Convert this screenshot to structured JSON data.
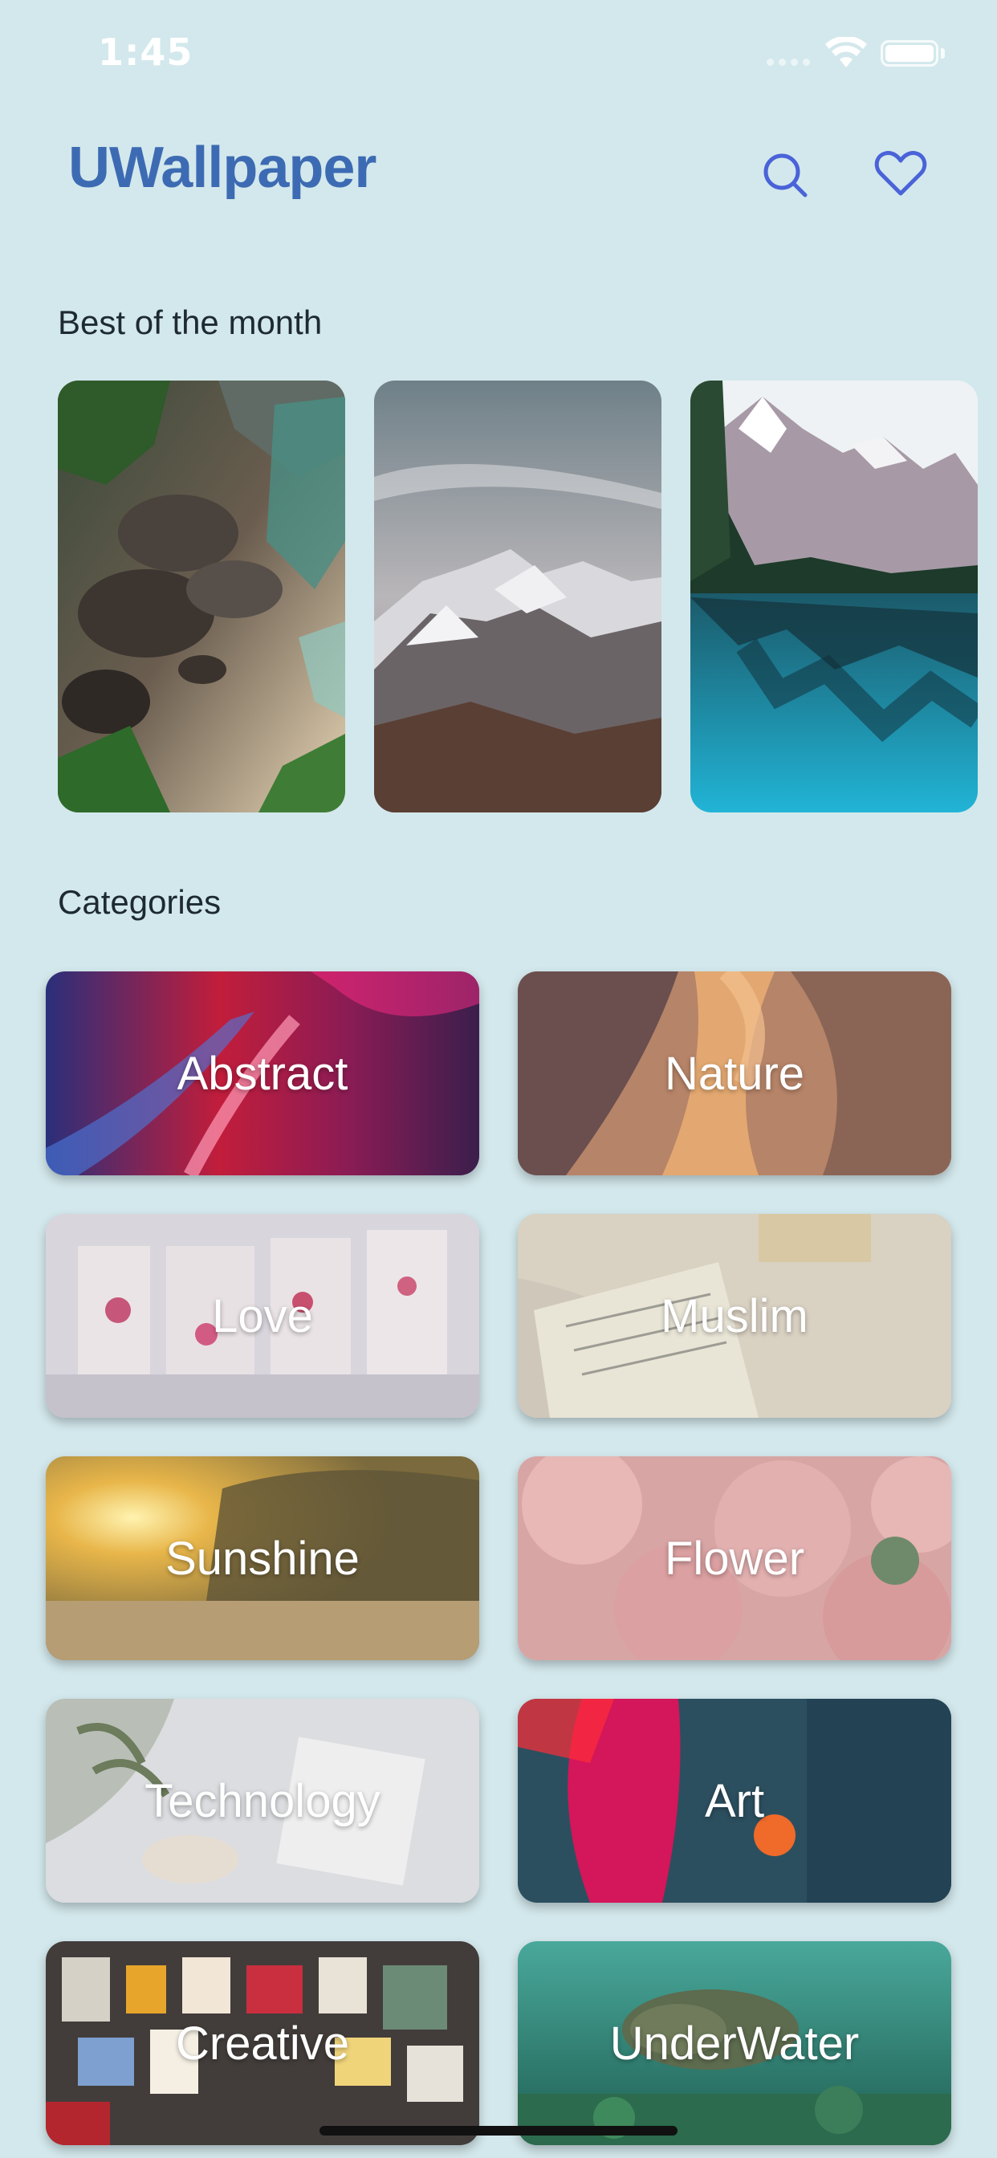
{
  "status_bar": {
    "time": "1:45"
  },
  "header": {
    "title": "UWallpaper",
    "search_icon": "search-icon",
    "favorites_icon": "heart-icon",
    "accent_color": "#3d6bb3",
    "icon_color": "#4a63d8"
  },
  "best_of_month": {
    "title": "Best of the month",
    "items": [
      {
        "name": "coastal-rocks-wallpaper"
      },
      {
        "name": "snowy-mountain-wallpaper"
      },
      {
        "name": "alpine-lake-wallpaper"
      }
    ]
  },
  "categories": {
    "title": "Categories",
    "items": [
      {
        "label": "Abstract"
      },
      {
        "label": "Nature"
      },
      {
        "label": "Love"
      },
      {
        "label": "Muslim"
      },
      {
        "label": "Sunshine"
      },
      {
        "label": "Flower"
      },
      {
        "label": "Technology"
      },
      {
        "label": "Art"
      },
      {
        "label": "Creative"
      },
      {
        "label": "UnderWater"
      }
    ]
  }
}
